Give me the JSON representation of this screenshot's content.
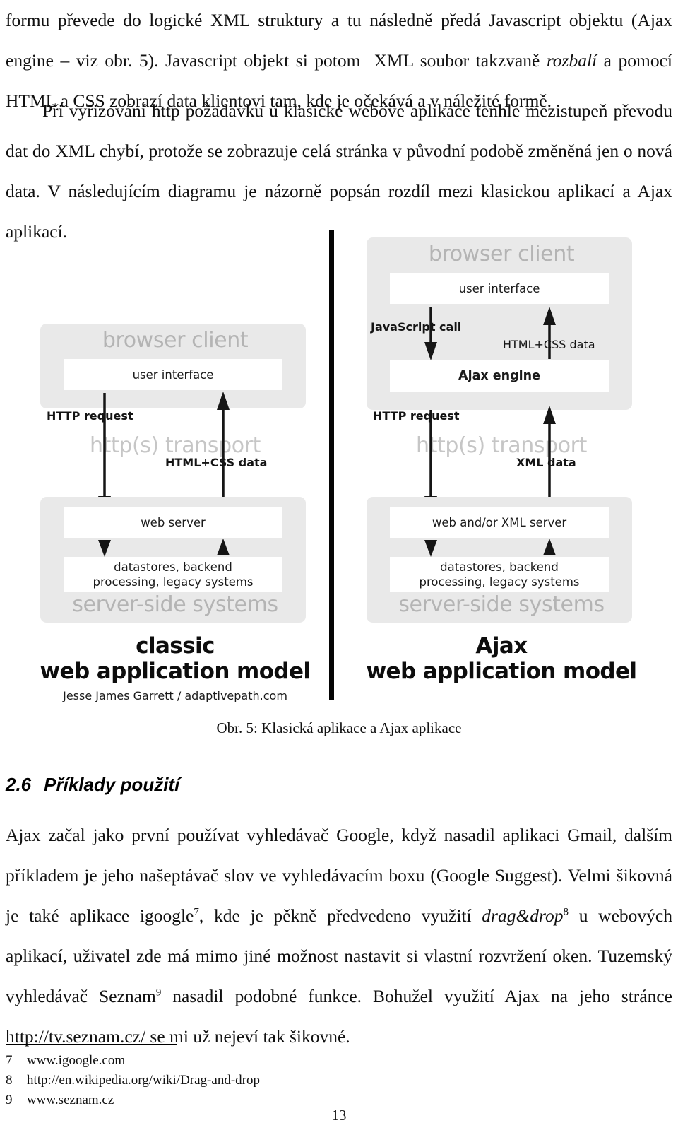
{
  "document": {
    "page_number": "13",
    "paragraphs": [
      {
        "id": "p1",
        "runs": [
          {
            "text": "formu převede do logické XML struktury a tu následně předá Javascript objektu (Ajax engine – viz obr. 5). Javascript objekt si potom  XML soubor takzvaně ",
            "style": "normal"
          },
          {
            "text": "rozbalí",
            "style": "italic"
          },
          {
            "text": " a pomocí HTML a CSS zobrazí data klientovi tam, kde je očekává a v náležité formě.",
            "style": "normal"
          }
        ]
      },
      {
        "id": "p2",
        "runs": [
          {
            "text": "Při vyřizování http požadavku u klasické webové aplikace tenhle mezistupeň převodu dat do XML chybí, protože se zobrazuje celá stránka v původní podobě změněná jen o nová data. V následujícím diagramu je názorně popsán rozdíl mezi klasickou aplikací a Ajax aplikací.",
            "style": "normal"
          }
        ]
      }
    ],
    "figure_caption": "Obr. 5: Klasická aplikace a Ajax aplikace",
    "section": {
      "number": "2.6",
      "title": "Příklady použití"
    },
    "paragraphs_after": [
      {
        "id": "p3",
        "runs": [
          {
            "text": "Ajax začal jako první používat vyhledávač Google, když nasadil aplikaci Gmail, dalším příkladem je jeho našeptávač slov ve vyhledávacím boxu (Google Suggest). Velmi šikovná je také aplikace igoogle",
            "style": "normal"
          },
          {
            "text": "7",
            "style": "superscript"
          },
          {
            "text": ", kde je pěkně předvedeno využití ",
            "style": "normal"
          },
          {
            "text": "drag&drop",
            "style": "italic"
          },
          {
            "text": "8",
            "style": "superscript"
          },
          {
            "text": " u webových aplikací, uživatel zde má mimo jiné možnost nastavit si vlastní rozvržení oken. Tuzemský vyhledávač Seznam",
            "style": "normal"
          },
          {
            "text": "9",
            "style": "superscript"
          },
          {
            "text": " nasadil podobné funkce. Bohužel využití Ajax na jeho stránce http://tv.seznam.cz/ se mi už nejeví tak šikovné.",
            "style": "normal"
          }
        ]
      }
    ],
    "footnotes": [
      {
        "num": "7",
        "text": "www.igoogle.com"
      },
      {
        "num": "8",
        "text": "http://en.wikipedia.org/wiki/Drag-and-drop"
      },
      {
        "num": "9",
        "text": "www.seznam.cz"
      }
    ]
  },
  "figure": {
    "colors": {
      "panel_grey": "#e9e9e9",
      "panel_label_grey": "#b4b4b4",
      "transport_grey": "#c6c6c6",
      "box_white": "#ffffff",
      "ink": "#111111",
      "divider": "#050505"
    },
    "classic": {
      "caption_line1": "classic",
      "caption_line2": "web application model",
      "credit": "Jesse James Garrett / adaptivepath.com",
      "client_panel_title": "browser client",
      "client_boxes": [
        {
          "label": "user interface",
          "bold": false
        }
      ],
      "transport_label": "http(s) transport",
      "server_panel_title": "server-side systems",
      "server_boxes": [
        {
          "label": "web server",
          "bold": false
        },
        {
          "label": "datastores, backend\nprocessing, legacy systems",
          "bold": false
        }
      ],
      "flows": [
        {
          "label": "HTTP request",
          "bold": true,
          "direction": "down"
        },
        {
          "label": "HTML+CSS data",
          "bold": true,
          "direction": "up"
        }
      ]
    },
    "ajax": {
      "caption_line1": "Ajax",
      "caption_line2": "web application model",
      "client_panel_title": "browser client",
      "client_boxes": [
        {
          "label": "user interface",
          "bold": false
        },
        {
          "label": "Ajax engine",
          "bold": true
        }
      ],
      "internal_flows": [
        {
          "label": "JavaScript call",
          "bold": true,
          "direction": "down"
        },
        {
          "label": "HTML+CSS data",
          "bold": false,
          "direction": "up"
        }
      ],
      "transport_label": "http(s) transport",
      "server_panel_title": "server-side systems",
      "server_boxes": [
        {
          "label": "web and/or XML server",
          "bold": false
        },
        {
          "label": "datastores, backend\nprocessing, legacy systems",
          "bold": false
        }
      ],
      "flows": [
        {
          "label": "HTTP request",
          "bold": true,
          "direction": "down"
        },
        {
          "label": "XML data",
          "bold": true,
          "direction": "up"
        }
      ]
    }
  }
}
